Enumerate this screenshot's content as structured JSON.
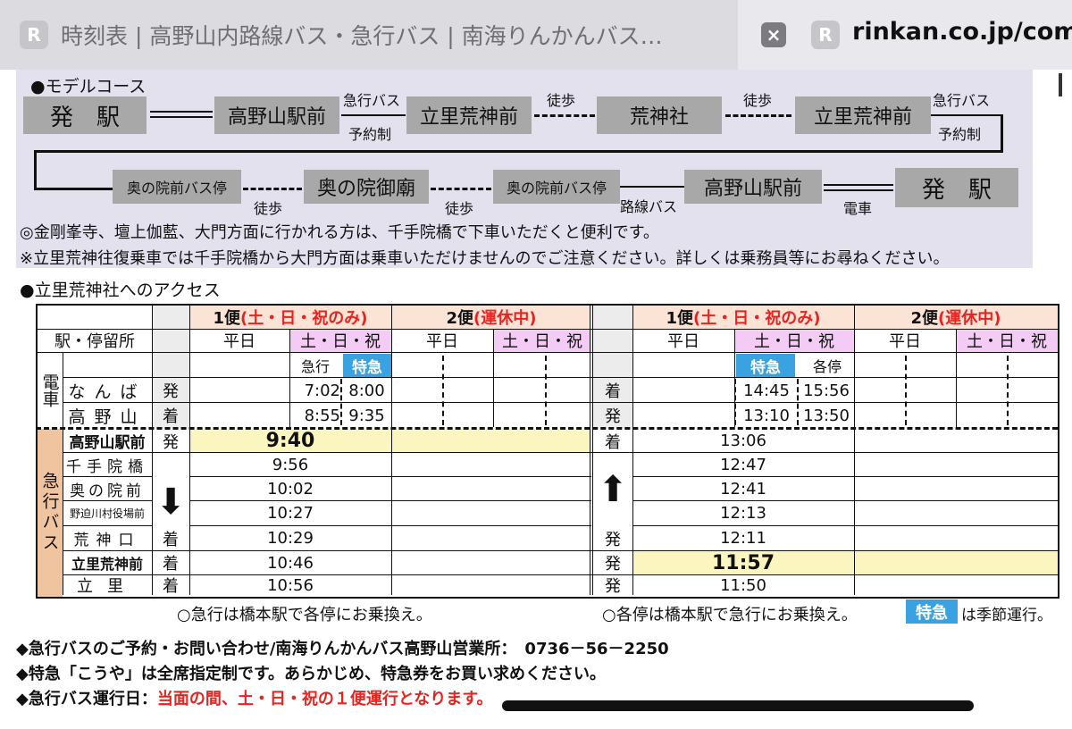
{
  "browser": {
    "tab_title": "時刻表 | 高野山内路線バス・急行バス | 南海りんかんバス…",
    "favicon_letter": "R",
    "close_glyph": "×",
    "url": "rinkan.co.jp/com"
  },
  "model_course": {
    "title": "●モデルコース",
    "depart": "発　駅",
    "koyasan_eki_mae": "高野山駅前",
    "tatesato_aragami_mae": "立里荒神前",
    "aragami_sha": "荒神社",
    "okunoin_mae_stop": "奥の院前バス停",
    "okunoin_gobyo": "奥の院御廟",
    "kyuko_bus": "急行バス",
    "yoyakusei": "予約制",
    "toho": "徒歩",
    "rosen_bus": "路線バス",
    "densha": "電車",
    "note1": "◎金剛峯寺、壇上伽藍、大門方面に行かれる方は、千手院橋で下車いただくと便利です。",
    "note2": "※立里荒神往復乗車では千手院橋から大門方面は乗車いただけませんのでご注意ください。詳しくは乗務員等にお尋ねください。"
  },
  "access": {
    "title": "●立里荒神社へのアクセス",
    "bin1": "1便",
    "bin1_note": "(土・日・祝のみ)",
    "bin2": "2便",
    "bin2_note": "(運休中)",
    "station_header": "駅・停留所",
    "heijitsu": "平日",
    "donichi": "土・日・祝",
    "kyuko": "急行",
    "tokkyu": "特急",
    "kakutei": "各停",
    "densha_label": "電車",
    "kyuko_bus_label": "急行バス",
    "stations": [
      "なんば",
      "高野山",
      "高野山駅前",
      "千手院橋",
      "奥の院前",
      "野迫川村役場前",
      "荒神口",
      "立里荒神前",
      "立里"
    ],
    "hatsu": "発",
    "chaku": "着",
    "out_train": {
      "namba": [
        "7:02",
        "8:00"
      ],
      "koya": [
        "8:55",
        "9:35"
      ]
    },
    "ret_train": {
      "namba": [
        "14:45",
        "15:56"
      ],
      "koya": [
        "13:10",
        "13:50"
      ]
    },
    "out_bus": [
      "9:40",
      "9:56",
      "10:02",
      "10:27",
      "10:29",
      "10:46",
      "10:56"
    ],
    "ret_bus": [
      "13:06",
      "12:47",
      "12:41",
      "12:13",
      "12:11",
      "11:57",
      "11:50"
    ],
    "arrow_down": "⬇",
    "arrow_up": "⬆",
    "foot_left": "○急行は橋本駅で各停にお乗換え。",
    "foot_right": "○各停は橋本駅で急行にお乗換え。",
    "foot_right_tail": "は季節運行。"
  },
  "bottom": {
    "line1": "◆急行バスのご予約・お問い合わせ/南海りんかんバス高野山営業所：　0736－56－2250",
    "line2": "◆特急「こうや」は全席指定制です。あらかじめ、特急券をお買い求めください。",
    "line3_prefix": "◆急行バス運行日：",
    "line3_red": "当面の間、土・日・祝の１便運行となります。"
  },
  "colors": {
    "tab_bg": "#e9e9ed",
    "course_bg": "#e4e1ef",
    "gray_box": "#a8a8a8",
    "header_peach": "#fbe3d6",
    "pink": "#f3cbf4",
    "blue": "#3aa2e0",
    "yellow": "#fbf5c0",
    "orange": "#f0c49e",
    "red": "#e8231f"
  }
}
